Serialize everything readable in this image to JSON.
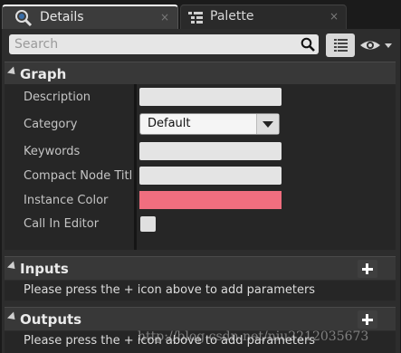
{
  "tabs": [
    {
      "label": "Details",
      "icon": "details-magnify-icon",
      "close": "×"
    },
    {
      "label": "Palette",
      "icon": "palette-list-icon",
      "close": "×"
    }
  ],
  "search": {
    "placeholder": "Search",
    "value": ""
  },
  "sections": {
    "graph": {
      "title": "Graph",
      "properties": [
        {
          "label": "Description",
          "value": ""
        },
        {
          "label": "Category",
          "value": "Default"
        },
        {
          "label": "Keywords",
          "value": ""
        },
        {
          "label": "Compact Node Title",
          "value": ""
        },
        {
          "label": "Instance Color",
          "value": "#F06E7F"
        },
        {
          "label": "Call In Editor",
          "checked": false
        }
      ]
    },
    "inputs": {
      "title": "Inputs",
      "message": "Please press the + icon above to add parameters"
    },
    "outputs": {
      "title": "Outputs",
      "message": "Please press the + icon above to add parameters"
    }
  },
  "watermark": "http://blog.csdn.net/niu2212035673",
  "colors": {
    "instance_color": "#F06E7F",
    "panel_bg": "#2D2D2D",
    "active_tab_border": "#FFFFFF"
  }
}
